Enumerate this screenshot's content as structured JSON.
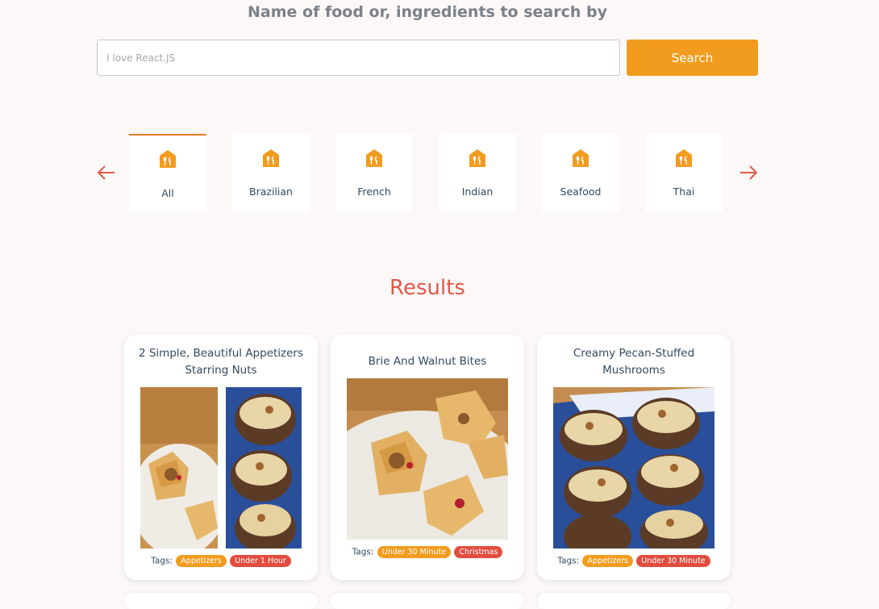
{
  "search": {
    "heading": "Name of food or, ingredients to search by",
    "placeholder": "I love React.JS",
    "button_label": "Search"
  },
  "categories": [
    {
      "label": "All",
      "active": true,
      "icon": "restaurant-icon"
    },
    {
      "label": "Brazilian",
      "active": false,
      "icon": "restaurant-icon"
    },
    {
      "label": "French",
      "active": false,
      "icon": "restaurant-icon"
    },
    {
      "label": "Indian",
      "active": false,
      "icon": "restaurant-icon"
    },
    {
      "label": "Seafood",
      "active": false,
      "icon": "restaurant-icon"
    },
    {
      "label": "Thai",
      "active": false,
      "icon": "restaurant-icon"
    }
  ],
  "results": {
    "title": "Results",
    "tags_label": "Tags:",
    "cards": [
      {
        "title": "2 Simple, Beautiful Appetizers Starring Nuts",
        "tags": [
          {
            "label": "Appetizers",
            "color": "#f29c1f"
          },
          {
            "label": "Under 1 Hour",
            "color": "#e14d3e"
          }
        ]
      },
      {
        "title": "Brie And Walnut Bites",
        "tags": [
          {
            "label": "Under 30 Minute",
            "color": "#f29c1f"
          },
          {
            "label": "Christmas",
            "color": "#e14d3e"
          }
        ]
      },
      {
        "title": "Creamy Pecan-Stuffed Mushrooms",
        "tags": [
          {
            "label": "Appetizers",
            "color": "#f29c1f"
          },
          {
            "label": "Under 30 Minute",
            "color": "#e14d3e"
          }
        ]
      }
    ]
  },
  "colors": {
    "accent": "#f29c1f",
    "active_tab_border": "#e67e22",
    "results_title": "#e05a4b",
    "arrow": "#e05a4b",
    "background": "#fdf8f8"
  }
}
